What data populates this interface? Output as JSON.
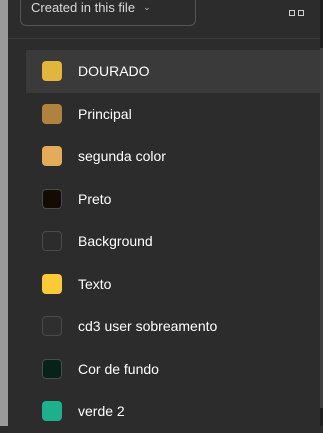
{
  "header": {
    "filter_label": "Created in this file",
    "filter_chevron": "⌄",
    "view_toggle_icon": "grid-view-icon"
  },
  "color_styles": [
    {
      "name": "DOURADO",
      "color": "#e2b53c",
      "selected": true
    },
    {
      "name": "Principal",
      "color": "#b0813f",
      "selected": false
    },
    {
      "name": "segunda color",
      "color": "#e4ac5a",
      "selected": false
    },
    {
      "name": "Preto",
      "color": "#120c02",
      "selected": false
    },
    {
      "name": "Background",
      "color": "#2c2c2c",
      "selected": false
    },
    {
      "name": "Texto",
      "color": "#fdc936",
      "selected": false
    },
    {
      "name": "cd3 user sobreamento",
      "color": "#2f2f2f",
      "selected": false
    },
    {
      "name": "Cor de fundo",
      "color": "#062219",
      "selected": false
    },
    {
      "name": "verde 2",
      "color": "#1eb08c",
      "selected": false
    }
  ]
}
